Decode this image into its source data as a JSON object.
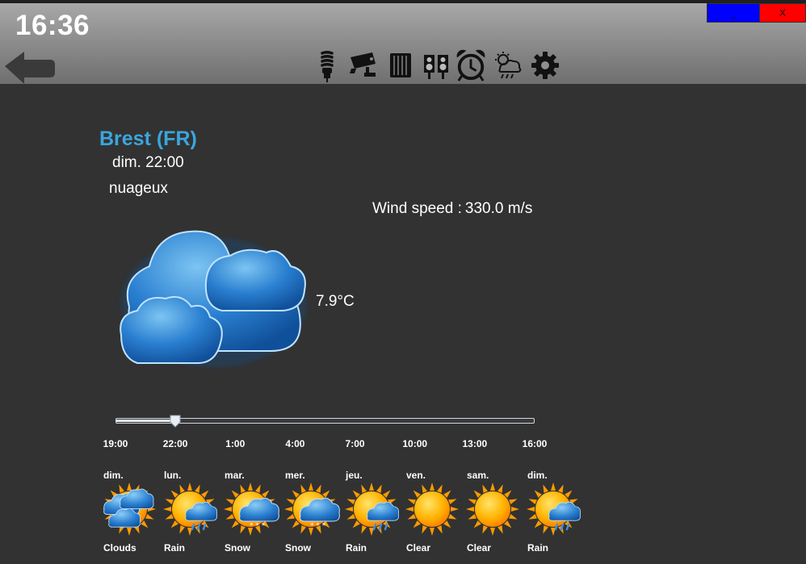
{
  "header": {
    "clock": "16:36",
    "minimize_label": "_",
    "close_label": "X",
    "tools": [
      {
        "name": "light-bulb-icon"
      },
      {
        "name": "security-camera-icon"
      },
      {
        "name": "radiator-icon"
      },
      {
        "name": "speakers-icon"
      },
      {
        "name": "alarm-clock-icon"
      },
      {
        "name": "weather-icon"
      },
      {
        "name": "gear-icon"
      }
    ]
  },
  "weather": {
    "city": "Brest (FR)",
    "datetime": "dim. 22:00",
    "description": "nuageux",
    "wind_label": "Wind speed :",
    "wind_value": "330.0 m/s",
    "temperature": "7.9°C",
    "icon": "clouds-icon"
  },
  "timeline": {
    "ticks": [
      "19:00",
      "22:00",
      "1:00",
      "4:00",
      "7:00",
      "10:00",
      "13:00",
      "16:00"
    ],
    "selected": "22:00",
    "position_fraction": 0.143
  },
  "forecast": [
    {
      "day": "dim.",
      "label": "Clouds",
      "icon": "clouds-icon"
    },
    {
      "day": "lun.",
      "label": "Rain",
      "icon": "sun-rain-icon"
    },
    {
      "day": "mar.",
      "label": "Snow",
      "icon": "sun-snow-icon"
    },
    {
      "day": "mer.",
      "label": "Snow",
      "icon": "sun-snow-icon"
    },
    {
      "day": "jeu.",
      "label": "Rain",
      "icon": "sun-rain-icon"
    },
    {
      "day": "ven.",
      "label": "Clear",
      "icon": "sun-icon"
    },
    {
      "day": "sam.",
      "label": "Clear",
      "icon": "sun-icon"
    },
    {
      "day": "dim.",
      "label": "Rain",
      "icon": "sun-rain-icon"
    }
  ],
  "colors": {
    "background": "#323232",
    "accent_city": "#3aa6de",
    "minimize": "#0000ff",
    "close": "#ff0000"
  }
}
